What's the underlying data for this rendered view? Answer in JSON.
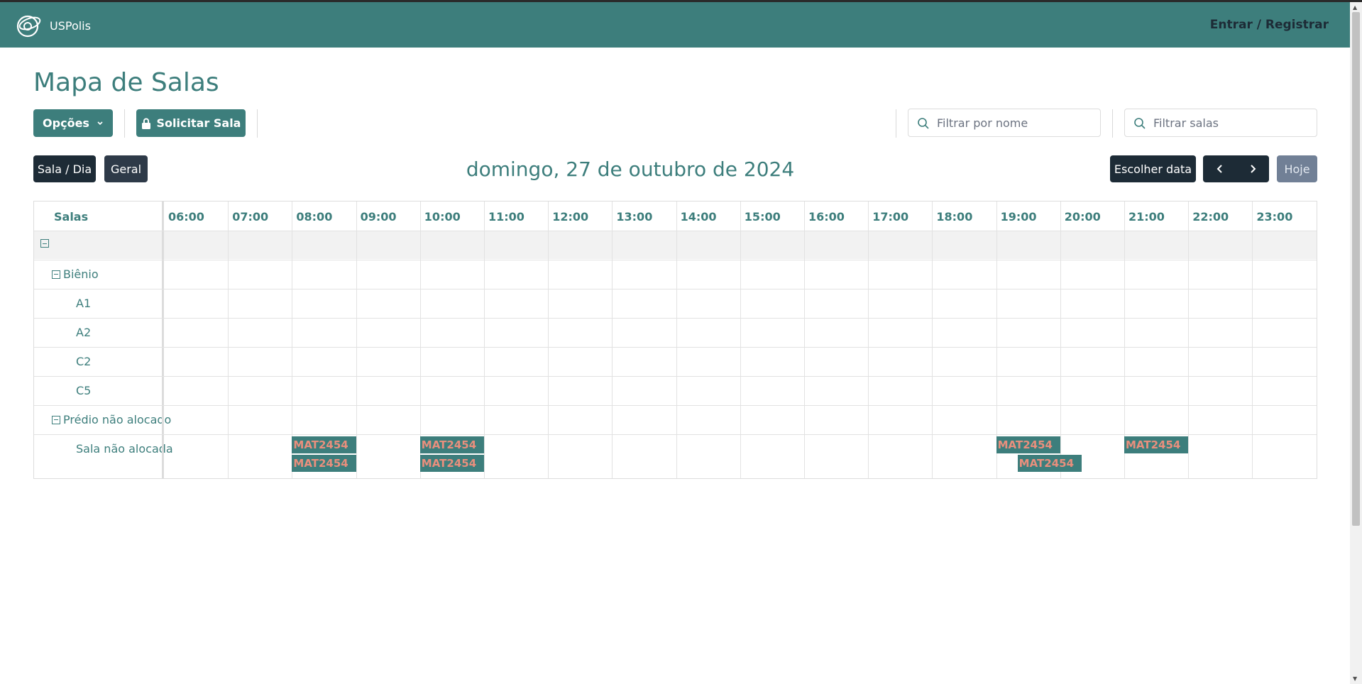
{
  "header": {
    "app_name": "USPolis",
    "login_label": "Entrar / Registrar"
  },
  "page": {
    "title": "Mapa de Salas"
  },
  "toolbar": {
    "options_label": "Opções",
    "request_label": "Solicitar Sala",
    "filter_name_placeholder": "Filtrar por nome",
    "filter_rooms_placeholder": "Filtrar salas"
  },
  "calendar": {
    "view_room_day": "Sala / Dia",
    "view_general": "Geral",
    "date_title": "domingo, 27 de outubro de 2024",
    "choose_date": "Escolher data",
    "today": "Hoje",
    "rooms_header": "Salas",
    "hours": [
      "06:00",
      "07:00",
      "08:00",
      "09:00",
      "10:00",
      "11:00",
      "12:00",
      "13:00",
      "14:00",
      "15:00",
      "16:00",
      "17:00",
      "18:00",
      "19:00",
      "20:00",
      "21:00",
      "22:00",
      "23:00"
    ],
    "groups": {
      "root": "",
      "bienio": "Biênio",
      "predio": "Prédio não alocado"
    },
    "rooms": {
      "a1": "A1",
      "a2": "A2",
      "c2": "C2",
      "c5": "C5",
      "nao_alocada": "Sala não alocada"
    },
    "events": [
      {
        "label": "MAT2454",
        "start": "08:00",
        "end": "09:00"
      },
      {
        "label": "MAT2454",
        "start": "08:00",
        "end": "09:00"
      },
      {
        "label": "MAT2454",
        "start": "10:00",
        "end": "11:00"
      },
      {
        "label": "MAT2454",
        "start": "10:00",
        "end": "11:00"
      },
      {
        "label": "MAT2454",
        "start": "19:00",
        "end": "20:00"
      },
      {
        "label": "MAT2454",
        "start": "19:20",
        "end": "20:20"
      },
      {
        "label": "MAT2454",
        "start": "21:00",
        "end": "22:00"
      }
    ]
  },
  "colors": {
    "primary": "#3d7e7c",
    "dark": "#1d2b36",
    "event_text": "#e98f7d"
  },
  "icons": {
    "logo": "uspolis-logo-icon",
    "chevron": "chevron-down-icon",
    "lock": "lock-icon",
    "search": "search-icon",
    "prev": "chevron-left-icon",
    "next": "chevron-right-icon"
  }
}
